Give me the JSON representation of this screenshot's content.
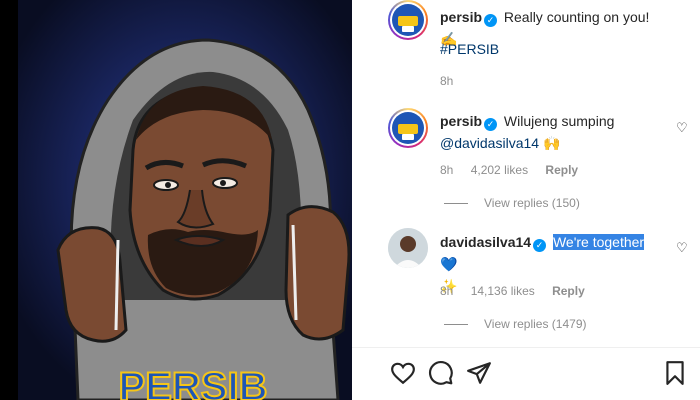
{
  "post": {
    "caption": {
      "username": "persib",
      "text": "Really counting on you! ✍️",
      "hashtag": "#PERSIB",
      "time": "8h"
    }
  },
  "comments": [
    {
      "username": "persib",
      "text": "Wilujeng sumping",
      "mention": "@davidasilva14",
      "emoji": "🙌",
      "time": "8h",
      "likes": "4,202 likes",
      "reply": "Reply",
      "view_replies": "View replies (150)"
    },
    {
      "username": "davidasilva14",
      "text": "We're together",
      "emoji": "💙",
      "emoji2": "✨",
      "time": "8h",
      "likes": "14,136 likes",
      "reply": "Reply",
      "view_replies": "View replies (1479)"
    }
  ],
  "illustration_text": "PERSIB",
  "colors": {
    "verified": "#0095f6",
    "link": "#00376b",
    "highlight": "#3584e4"
  },
  "icons": [
    "heart-icon",
    "comment-icon",
    "share-icon",
    "bookmark-icon",
    "verified-badge-icon"
  ]
}
